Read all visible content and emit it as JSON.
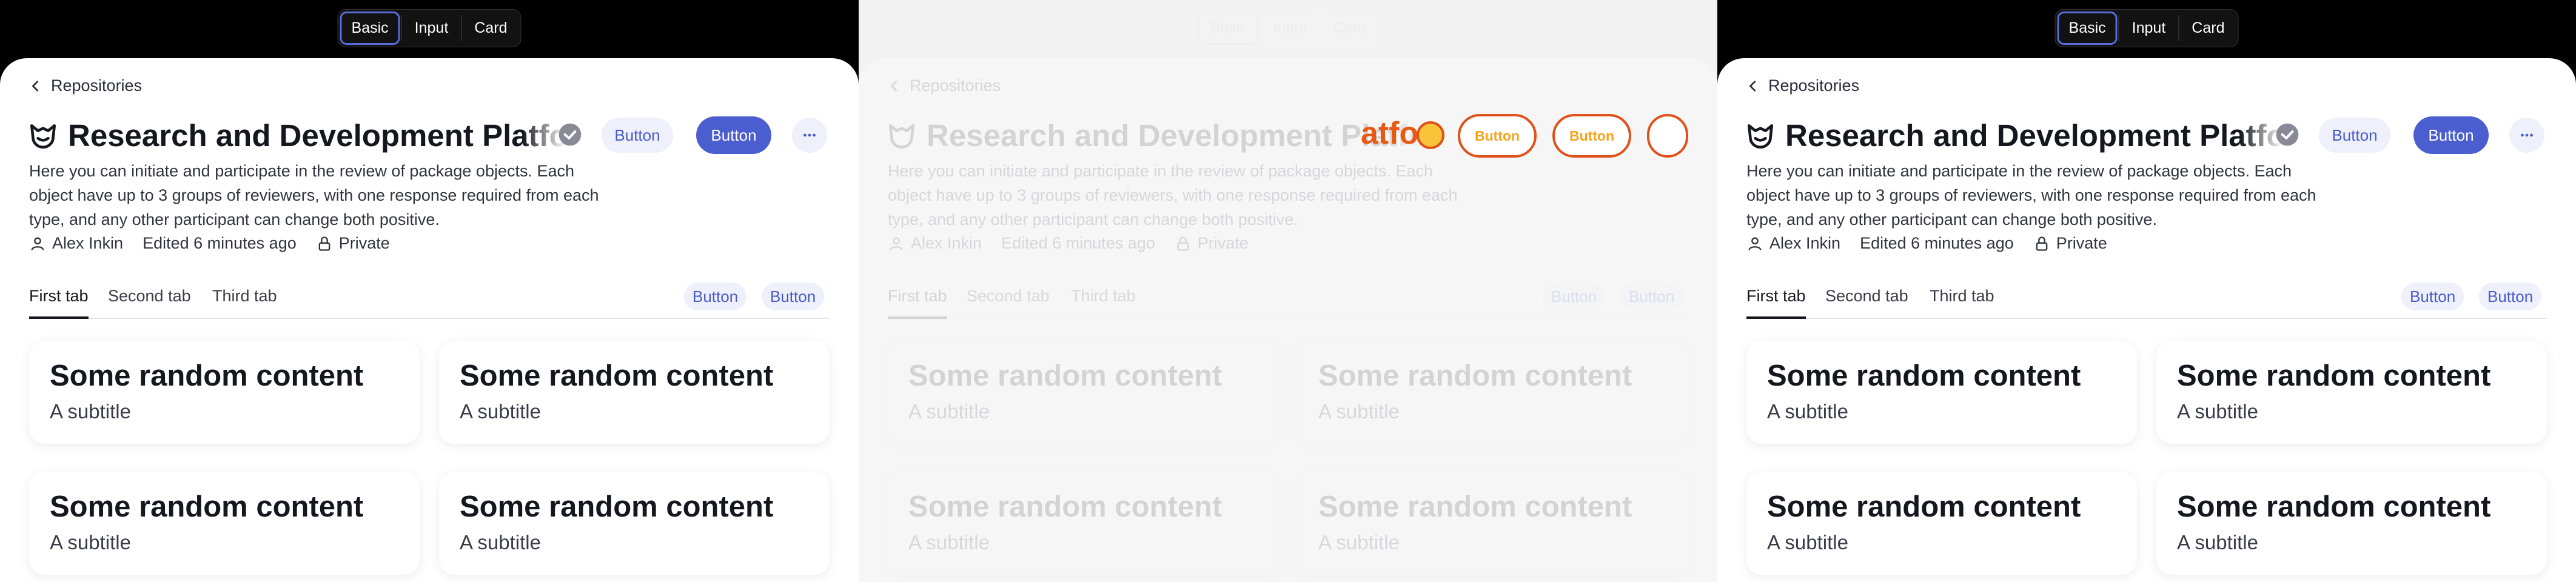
{
  "segmented": {
    "options": [
      "Basic",
      "Input",
      "Card"
    ],
    "selected": "Basic"
  },
  "header": {
    "back_label": "Repositories",
    "title": "Research and Development Platform",
    "button_secondary": "Button",
    "button_primary": "Button"
  },
  "description": "Here you can initiate and participate in the review of package objects. Each object have up to 3 groups of reviewers, with one response required from each type, and any other participant can change both positive.",
  "meta": {
    "author": "Alex Inkin",
    "edited": "Edited 6 minutes ago",
    "visibility": "Private"
  },
  "tabs": {
    "items": [
      "First tab",
      "Second tab",
      "Third tab"
    ],
    "active": "First tab",
    "actions": [
      "Button",
      "Button"
    ]
  },
  "cards": [
    {
      "title": "Some random content",
      "subtitle": "A subtitle"
    },
    {
      "title": "Some random content",
      "subtitle": "A subtitle"
    },
    {
      "title": "Some random content",
      "subtitle": "A subtitle"
    },
    {
      "title": "Some random content",
      "subtitle": "A subtitle"
    }
  ],
  "glitch": {
    "fragment": "atfo",
    "pill_label": "Button"
  },
  "colors": {
    "primary": "#4b5ed0",
    "soft": "#eef0fb",
    "accent_orange": "#e0521b"
  },
  "icons": [
    "chevron-left-icon",
    "logo-icon",
    "check-badge-icon",
    "more-icon",
    "user-icon",
    "lock-icon"
  ]
}
